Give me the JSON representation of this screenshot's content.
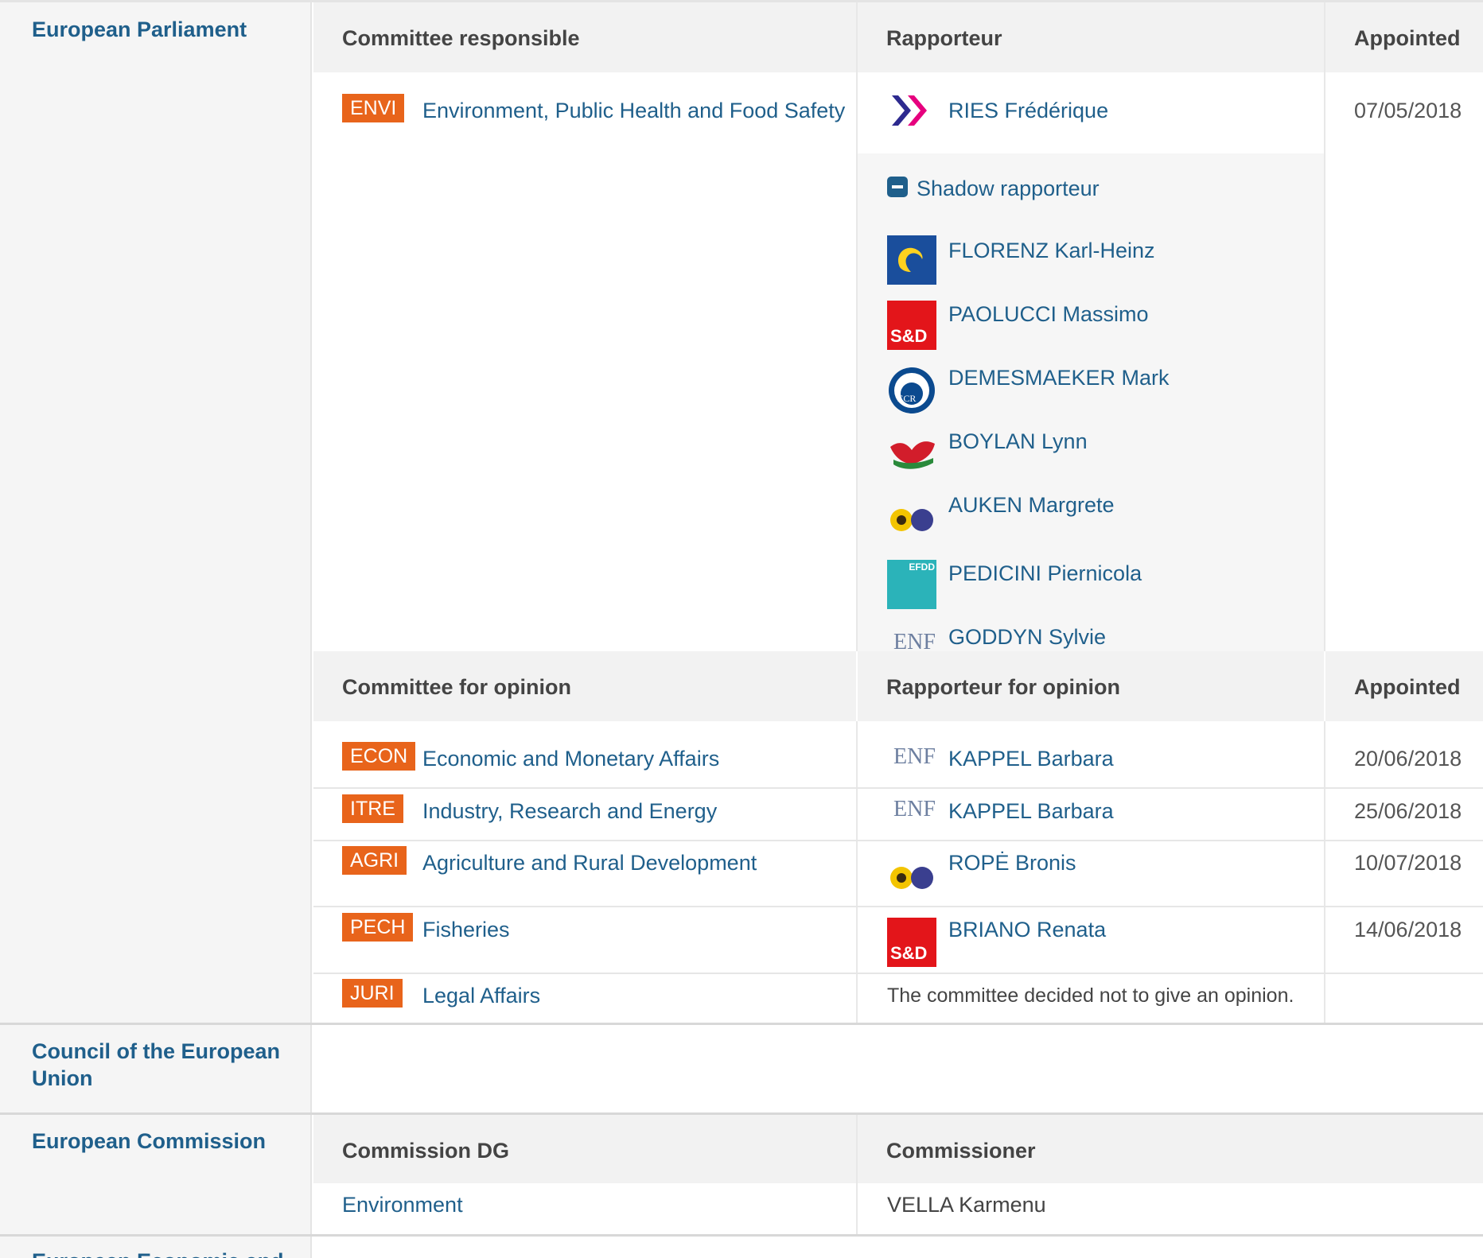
{
  "ep": {
    "name": "European Parliament",
    "responsible": {
      "headers": {
        "committee": "Committee responsible",
        "rapporteur": "Rapporteur",
        "appointed": "Appointed"
      },
      "badge": "ENVI",
      "committee": "Environment, Public Health and Food Safety",
      "rapporteur": "RIES Frédérique",
      "date": "07/05/2018",
      "shadow_label": "Shadow rapporteur",
      "shadows": [
        {
          "name": "FLORENZ Karl-Heinz",
          "logo": "epp-logo"
        },
        {
          "name": "PAOLUCCI Massimo",
          "logo": "sd-logo",
          "logo_text": "S&D"
        },
        {
          "name": "DEMESMAEKER Mark",
          "logo": "ecr-logo",
          "logo_text": "ECR"
        },
        {
          "name": "BOYLAN Lynn",
          "logo": "gue-logo"
        },
        {
          "name": "AUKEN Margrete",
          "logo": "greens-logo"
        },
        {
          "name": "PEDICINI Piernicola",
          "logo": "efdd-logo",
          "logo_text": "EFDD"
        },
        {
          "name": "GODDYN Sylvie",
          "logo": "enf-logo",
          "logo_text": "ENF"
        }
      ]
    },
    "opinion": {
      "headers": {
        "committee": "Committee for opinion",
        "rapporteur": "Rapporteur for opinion",
        "appointed": "Appointed"
      },
      "rows": [
        {
          "badge": "ECON",
          "committee": "Economic and Monetary Affairs",
          "rapporteur": "KAPPEL Barbara",
          "logo": "enf-logo",
          "logo_text": "ENF",
          "date": "20/06/2018"
        },
        {
          "badge": "ITRE",
          "committee": "Industry, Research and Energy",
          "rapporteur": "KAPPEL Barbara",
          "logo": "enf-logo",
          "logo_text": "ENF",
          "date": "25/06/2018"
        },
        {
          "badge": "AGRI",
          "committee": "Agriculture and Rural Development",
          "rapporteur": "ROPĖ Bronis",
          "logo": "greens-logo",
          "date": "10/07/2018"
        },
        {
          "badge": "PECH",
          "committee": "Fisheries",
          "rapporteur": "BRIANO Renata",
          "logo": "sd-logo",
          "logo_text": "S&D",
          "date": "14/06/2018"
        },
        {
          "badge": "JURI",
          "committee": "Legal Affairs",
          "note": "The committee decided not to give an opinion."
        }
      ]
    }
  },
  "council": {
    "name": "Council of the European Union"
  },
  "commission": {
    "name": "European Commission",
    "headers": {
      "dg": "Commission DG",
      "commissioner": "Commissioner"
    },
    "dg": "Environment",
    "commissioner": "VELLA Karmenu"
  },
  "eesc": {
    "name": "European Economic and"
  },
  "colors": {
    "badge": "#e8641b",
    "link": "#1f5f8b",
    "sd_red": "#e3151a",
    "epp_blue": "#1a4e9c"
  }
}
